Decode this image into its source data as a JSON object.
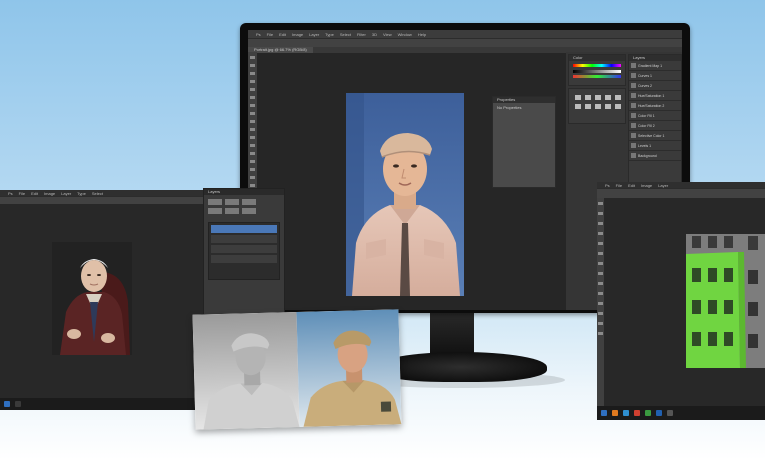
{
  "central": {
    "menu": [
      "Ps",
      "File",
      "Edit",
      "Image",
      "Layer",
      "Type",
      "Select",
      "Filter",
      "3D",
      "View",
      "Window",
      "Help"
    ],
    "tab": "Portrait.jpg @ 66.7% (RGB/8)",
    "panel_title": "Properties",
    "panel_subtitle": "No Properties",
    "layers_title": "Layers",
    "layer_items": [
      "Gradient Map 1",
      "Curves 1",
      "Curves 2",
      "Hue/Saturation 1",
      "Hue/Saturation 2",
      "Color Fill 1",
      "Color Fill 2",
      "Selective Color 1",
      "Levels 1",
      "Background"
    ],
    "swatches_title": "Color"
  },
  "left": {
    "menu": [
      "Ps",
      "File",
      "Edit",
      "Image",
      "Layer",
      "Type",
      "Select"
    ],
    "layers_title": "Layers"
  },
  "right": {
    "menu": [
      "Ps",
      "File",
      "Edit",
      "Image",
      "Layer"
    ]
  },
  "colors": {
    "ps_bg": "#282828",
    "ps_panel": "#3a3a3a",
    "accent_blue": "#4a78b8",
    "mask_green": "#6fdc3c",
    "khaki": "#c9ad7b"
  }
}
